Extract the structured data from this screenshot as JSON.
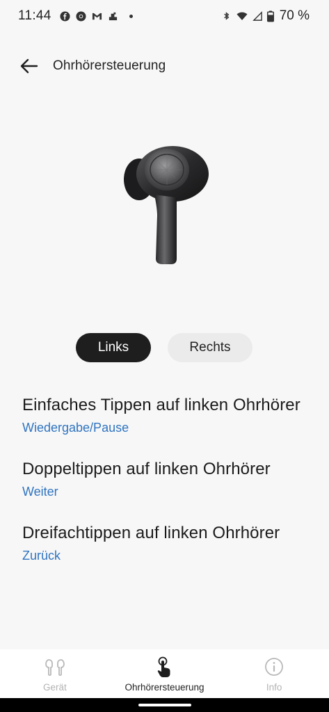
{
  "status_bar": {
    "time": "11:44",
    "battery": "70 %",
    "icons": [
      "facebook-icon",
      "chrome-icon",
      "gmail-icon",
      "app-icon",
      "notification-dot",
      "bluetooth-icon",
      "wifi-icon",
      "signal-icon",
      "battery-icon"
    ]
  },
  "app_bar": {
    "title": "Ohrhörersteuerung",
    "back_icon": "arrow-left-icon"
  },
  "segments": {
    "left": "Links",
    "right": "Rechts",
    "selected": "Links"
  },
  "settings": [
    {
      "title": "Einfaches Tippen auf linken Ohrhörer",
      "value": "Wiedergabe/Pause"
    },
    {
      "title": "Doppeltippen auf linken Ohrhörer",
      "value": "Weiter"
    },
    {
      "title": "Dreifachtippen auf linken Ohrhörer",
      "value": "Zurück"
    }
  ],
  "bottom_nav": {
    "items": [
      {
        "label": "Gerät",
        "icon": "earbuds-icon",
        "active": false
      },
      {
        "label": "Ohrhörersteuerung",
        "icon": "touch-icon",
        "active": true
      },
      {
        "label": "Info",
        "icon": "info-icon",
        "active": false
      }
    ]
  },
  "colors": {
    "accent_link": "#2f74c0",
    "segment_selected": "#1e1e1e",
    "segment_unselected": "#ebebeb",
    "background": "#f7f7f7"
  }
}
